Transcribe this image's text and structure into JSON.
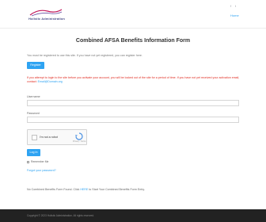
{
  "header": {
    "logo_text": "Holistic Administration",
    "nav_link": "Home",
    "facebook_icon": "f",
    "twitter_icon": "t"
  },
  "title": "Combined AFSA Benefits Information Form",
  "register_note": "You must be registered to use this site. If you have not yet registered, you can register here.",
  "register_button": "Register",
  "warning": {
    "text": "If you attempt to login to the site before you activate your account, you will be locked out of the site for a period of time. If you have not yet received your activation email, contact:",
    "link": "Email@Domain.org"
  },
  "form": {
    "username_label": "Username",
    "password_label": "Password",
    "captcha_label": "I'm not a robot",
    "captcha_brand": "Privacy - Terms",
    "login_button": "Log In",
    "remember_label": "Remember Me",
    "forgot_link": "Forgot your password?"
  },
  "bottom": {
    "prefix": "No Combined Benefits Form Found. Click",
    "link": "HERE",
    "suffix": "to Start Your Combined Benefits Form Entry."
  },
  "footer": {
    "text": "Copyright © 2023 Holistic Administration. All rights reserved."
  },
  "colors": {
    "accent": "#2ea3f2",
    "warning": "#e02b20",
    "footer": "#222222"
  }
}
